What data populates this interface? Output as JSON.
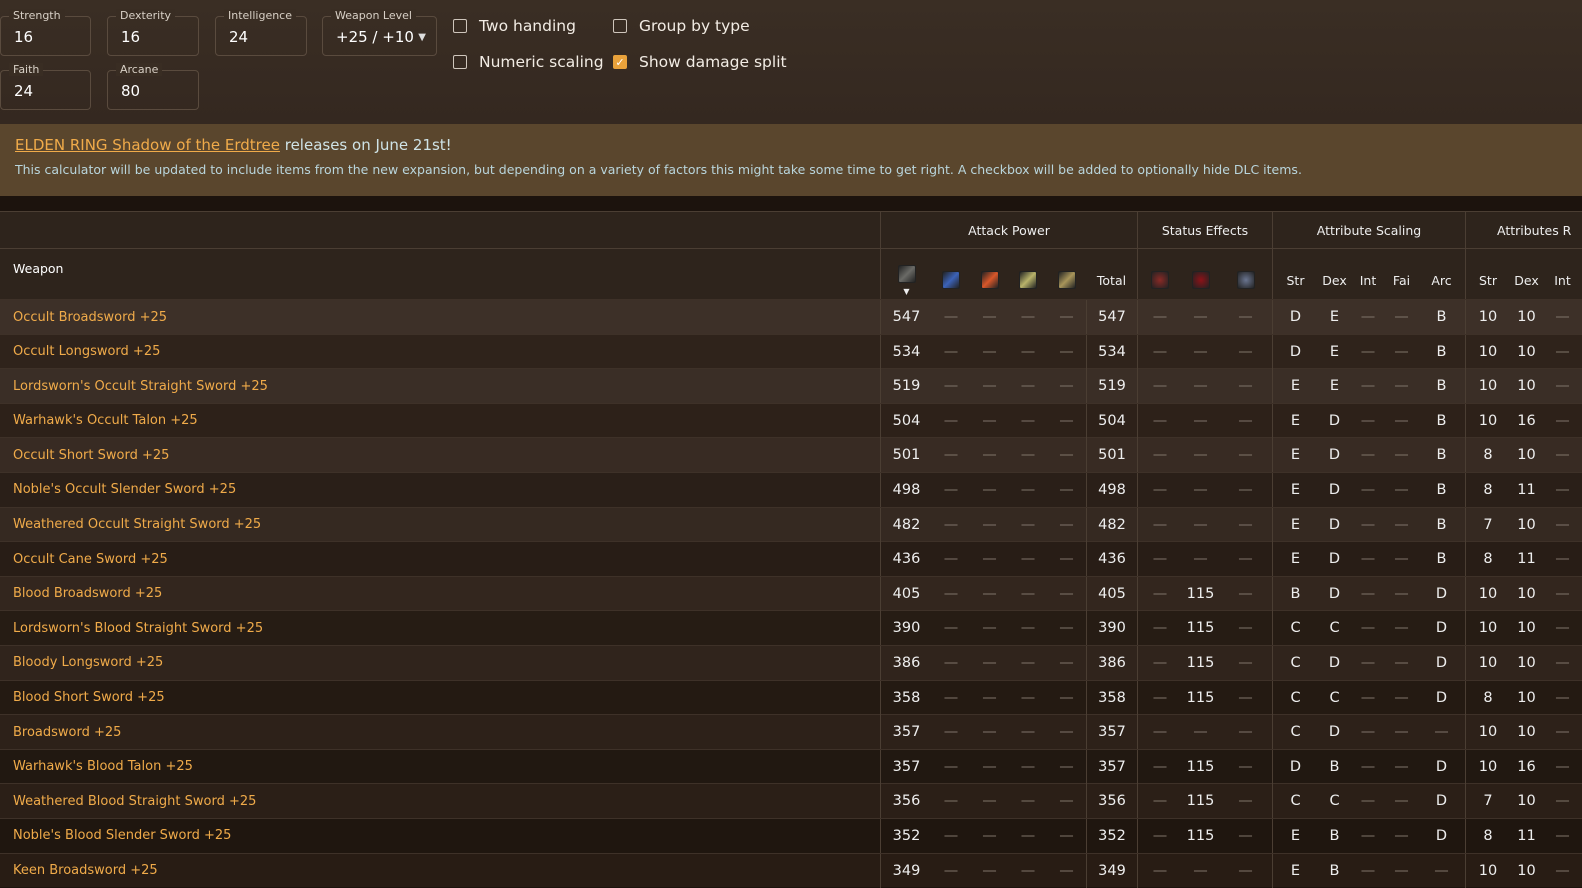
{
  "stats": [
    {
      "label": "Strength",
      "value": "16"
    },
    {
      "label": "Dexterity",
      "value": "16"
    },
    {
      "label": "Intelligence",
      "value": "24"
    },
    {
      "label": "Weapon Level",
      "value": "+25 / +10"
    },
    {
      "label": "Faith",
      "value": "24"
    },
    {
      "label": "Arcane",
      "value": "80"
    }
  ],
  "options": [
    {
      "label": "Two handing",
      "checked": false
    },
    {
      "label": "Group by type",
      "checked": false
    },
    {
      "label": "Numeric scaling",
      "checked": false
    },
    {
      "label": "Show damage split",
      "checked": true
    }
  ],
  "banner": {
    "link": "ELDEN RING Shadow of the Erdtree",
    "title_rest": " releases on June 21st!",
    "desc": "This calculator will be updated to include items from the new expansion, but depending on a variety of factors this might take some time to get right. A checkbox will be added to optionally hide DLC items."
  },
  "table": {
    "groups": {
      "attack": "Attack Power",
      "status": "Status Effects",
      "scaling": "Attribute Scaling",
      "attributes": "Attributes R"
    },
    "weapon_header": "Weapon",
    "ap_icons": [
      {
        "name": "physical-damage-icon",
        "color": "#6a6a66"
      },
      {
        "name": "magic-damage-icon",
        "color": "#3c63b8"
      },
      {
        "name": "fire-damage-icon",
        "color": "#d8572a"
      },
      {
        "name": "lightning-damage-icon",
        "color": "#b8b36a"
      },
      {
        "name": "holy-damage-icon",
        "color": "#a8955a"
      }
    ],
    "total_header": "Total",
    "status_icons": [
      {
        "name": "scarlet-rot-icon",
        "color": "#8a2a26"
      },
      {
        "name": "bleed-icon",
        "color": "#8d1218"
      },
      {
        "name": "frost-icon",
        "color": "#6a7590"
      }
    ],
    "scaling_headers": [
      "Str",
      "Dex",
      "Int",
      "Fai",
      "Arc"
    ],
    "attr_headers": [
      "Str",
      "Dex",
      "Int"
    ],
    "rows": [
      [
        "Occult Broadsword +25",
        "547",
        "—",
        "—",
        "—",
        "—",
        "547",
        "—",
        "—",
        "—",
        "D",
        "E",
        "—",
        "—",
        "B",
        "10",
        "10",
        "—"
      ],
      [
        "Occult Longsword +25",
        "534",
        "—",
        "—",
        "—",
        "—",
        "534",
        "—",
        "—",
        "—",
        "D",
        "E",
        "—",
        "—",
        "B",
        "10",
        "10",
        "—"
      ],
      [
        "Lordsworn's Occult Straight Sword +25",
        "519",
        "—",
        "—",
        "—",
        "—",
        "519",
        "—",
        "—",
        "—",
        "E",
        "E",
        "—",
        "—",
        "B",
        "10",
        "10",
        "—"
      ],
      [
        "Warhawk's Occult Talon +25",
        "504",
        "—",
        "—",
        "—",
        "—",
        "504",
        "—",
        "—",
        "—",
        "E",
        "D",
        "—",
        "—",
        "B",
        "10",
        "16",
        "—"
      ],
      [
        "Occult Short Sword +25",
        "501",
        "—",
        "—",
        "—",
        "—",
        "501",
        "—",
        "—",
        "—",
        "E",
        "D",
        "—",
        "—",
        "B",
        "8",
        "10",
        "—"
      ],
      [
        "Noble's Occult Slender Sword +25",
        "498",
        "—",
        "—",
        "—",
        "—",
        "498",
        "—",
        "—",
        "—",
        "E",
        "D",
        "—",
        "—",
        "B",
        "8",
        "11",
        "—"
      ],
      [
        "Weathered Occult Straight Sword +25",
        "482",
        "—",
        "—",
        "—",
        "—",
        "482",
        "—",
        "—",
        "—",
        "E",
        "D",
        "—",
        "—",
        "B",
        "7",
        "10",
        "—"
      ],
      [
        "Occult Cane Sword +25",
        "436",
        "—",
        "—",
        "—",
        "—",
        "436",
        "—",
        "—",
        "—",
        "E",
        "D",
        "—",
        "—",
        "B",
        "8",
        "11",
        "—"
      ],
      [
        "Blood Broadsword +25",
        "405",
        "—",
        "—",
        "—",
        "—",
        "405",
        "—",
        "115",
        "—",
        "B",
        "D",
        "—",
        "—",
        "D",
        "10",
        "10",
        "—"
      ],
      [
        "Lordsworn's Blood Straight Sword +25",
        "390",
        "—",
        "—",
        "—",
        "—",
        "390",
        "—",
        "115",
        "—",
        "C",
        "C",
        "—",
        "—",
        "D",
        "10",
        "10",
        "—"
      ],
      [
        "Bloody Longsword +25",
        "386",
        "—",
        "—",
        "—",
        "—",
        "386",
        "—",
        "115",
        "—",
        "C",
        "D",
        "—",
        "—",
        "D",
        "10",
        "10",
        "—"
      ],
      [
        "Blood Short Sword +25",
        "358",
        "—",
        "—",
        "—",
        "—",
        "358",
        "—",
        "115",
        "—",
        "C",
        "C",
        "—",
        "—",
        "D",
        "8",
        "10",
        "—"
      ],
      [
        "Broadsword +25",
        "357",
        "—",
        "—",
        "—",
        "—",
        "357",
        "—",
        "—",
        "—",
        "C",
        "D",
        "—",
        "—",
        "—",
        "10",
        "10",
        "—"
      ],
      [
        "Warhawk's Blood Talon +25",
        "357",
        "—",
        "—",
        "—",
        "—",
        "357",
        "—",
        "115",
        "—",
        "D",
        "B",
        "—",
        "—",
        "D",
        "10",
        "16",
        "—"
      ],
      [
        "Weathered Blood Straight Sword +25",
        "356",
        "—",
        "—",
        "—",
        "—",
        "356",
        "—",
        "115",
        "—",
        "C",
        "C",
        "—",
        "—",
        "D",
        "7",
        "10",
        "—"
      ],
      [
        "Noble's Blood Slender Sword +25",
        "352",
        "—",
        "—",
        "—",
        "—",
        "352",
        "—",
        "115",
        "—",
        "E",
        "B",
        "—",
        "—",
        "D",
        "8",
        "11",
        "—"
      ],
      [
        "Keen Broadsword +25",
        "349",
        "—",
        "—",
        "—",
        "—",
        "349",
        "—",
        "—",
        "—",
        "E",
        "B",
        "—",
        "—",
        "—",
        "10",
        "10",
        "—"
      ]
    ]
  },
  "colors": {
    "accent": "#e9a23b",
    "weapon_name": "#f0ab4a",
    "banner_bg": "#5a462d"
  }
}
